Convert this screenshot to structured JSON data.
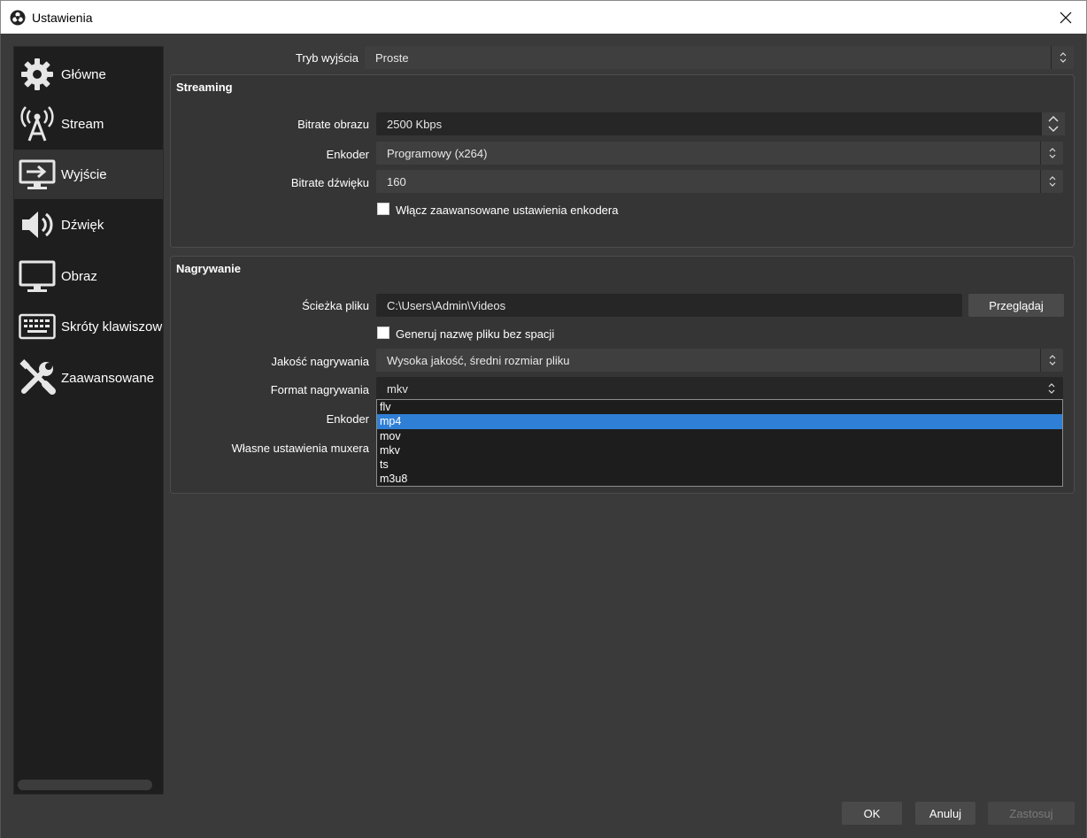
{
  "window": {
    "title": "Ustawienia",
    "app_icon": "obs-logo-icon",
    "close_icon": "close-icon"
  },
  "sidebar": {
    "items": [
      {
        "label": "Główne",
        "icon": "gear-icon",
        "active": false
      },
      {
        "label": "Stream",
        "icon": "broadcast-tower-icon",
        "active": false
      },
      {
        "label": "Wyjście",
        "icon": "output-monitor-icon",
        "active": true
      },
      {
        "label": "Dźwięk",
        "icon": "speaker-icon",
        "active": false
      },
      {
        "label": "Obraz",
        "icon": "monitor-icon",
        "active": false
      },
      {
        "label": "Skróty klawiszowe",
        "icon": "keyboard-icon",
        "active": false
      },
      {
        "label": "Zaawansowane",
        "icon": "tools-icon",
        "active": false
      }
    ]
  },
  "output_mode": {
    "label": "Tryb wyjścia",
    "value": "Proste"
  },
  "streaming": {
    "title": "Streaming",
    "video_bitrate_label": "Bitrate obrazu",
    "video_bitrate_value": "2500 Kbps",
    "encoder_label": "Enkoder",
    "encoder_value": "Programowy (x264)",
    "audio_bitrate_label": "Bitrate dźwięku",
    "audio_bitrate_value": "160",
    "advanced_checkbox_label": "Włącz zaawansowane ustawienia enkodera",
    "advanced_checked": false
  },
  "recording": {
    "title": "Nagrywanie",
    "path_label": "Ścieżka pliku",
    "path_value": "C:\\Users\\Admin\\Videos",
    "browse_label": "Przeglądaj",
    "nospace_checkbox_label": "Generuj nazwę pliku bez spacji",
    "nospace_checked": false,
    "quality_label": "Jakość nagrywania",
    "quality_value": "Wysoka jakość, średni rozmiar pliku",
    "format_label": "Format nagrywania",
    "format_value": "mkv",
    "encoder_label": "Enkoder",
    "muxer_label": "Własne ustawienia muxera",
    "format_options": [
      "flv",
      "mp4",
      "mov",
      "mkv",
      "ts",
      "m3u8"
    ],
    "format_highlighted": "mp4"
  },
  "footer": {
    "ok_label": "OK",
    "cancel_label": "Anuluj",
    "apply_label": "Zastosuj"
  },
  "colors": {
    "background": "#3a3a3a",
    "sidebar": "#1e1e1e",
    "selection": "#2f7fd6"
  }
}
